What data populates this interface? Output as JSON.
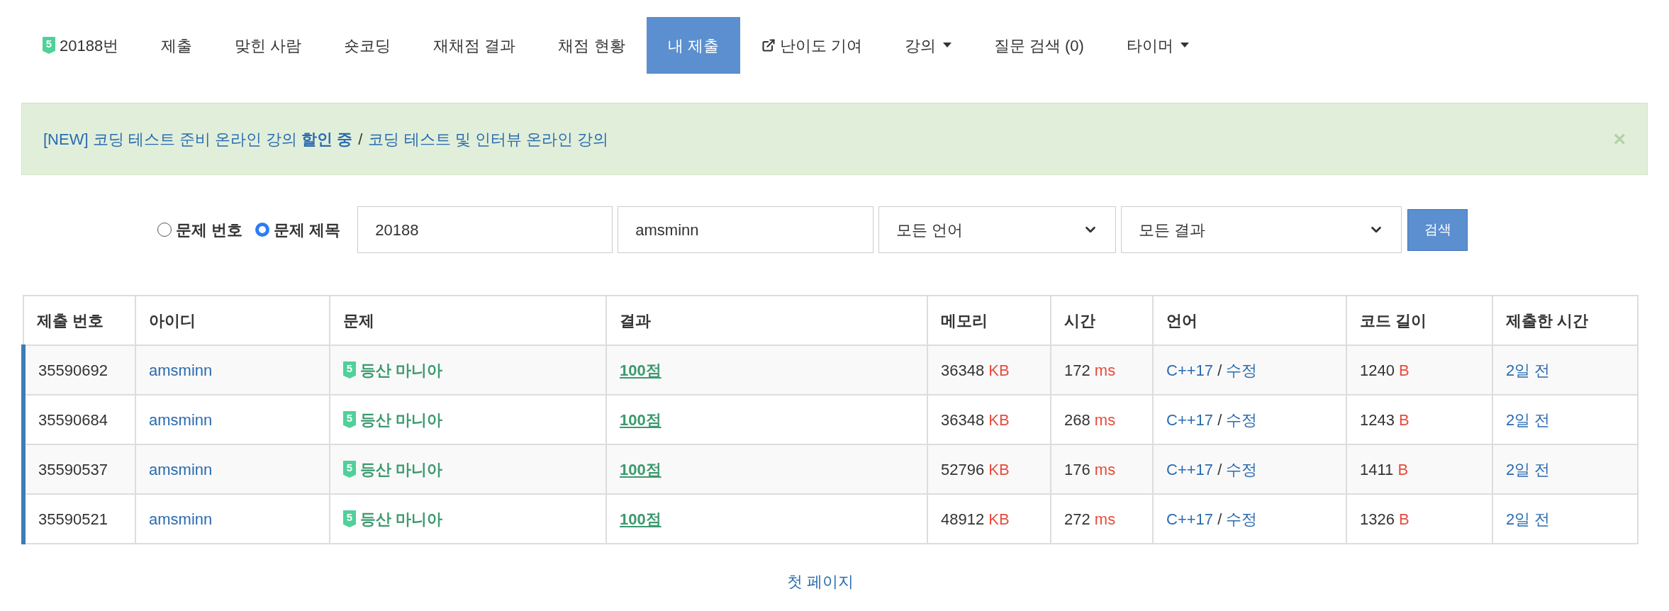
{
  "nav": [
    {
      "label": "20188번",
      "kind": "problem",
      "tier": "5",
      "selected": false
    },
    {
      "label": "제출",
      "kind": "plain",
      "selected": false
    },
    {
      "label": "맞힌 사람",
      "kind": "plain",
      "selected": false
    },
    {
      "label": "숏코딩",
      "kind": "plain",
      "selected": false
    },
    {
      "label": "재채점 결과",
      "kind": "plain",
      "selected": false
    },
    {
      "label": "채점 현황",
      "kind": "plain",
      "selected": false
    },
    {
      "label": "내 제출",
      "kind": "plain",
      "selected": true
    },
    {
      "label": "난이도 기여",
      "kind": "external",
      "selected": false
    },
    {
      "label": "강의",
      "kind": "dropdown",
      "selected": false
    },
    {
      "label": "질문 검색 (0)",
      "kind": "plain",
      "selected": false
    },
    {
      "label": "타이머",
      "kind": "dropdown",
      "selected": false
    }
  ],
  "alert": {
    "link_1": "[NEW] 코딩 테스트 준비 온라인 강의 **할인 중**",
    "separator": "/",
    "link_2": "코딩 테스트 및 인터뷰 온라인 강의",
    "close": "×"
  },
  "search": {
    "radios": [
      {
        "label": "문제 번호",
        "selected": false
      },
      {
        "label": "문제 제목",
        "selected": true
      }
    ],
    "problem_value": "20188",
    "user_value": "amsminn",
    "language": "모든 언어",
    "result": "모든 결과",
    "button": "검색"
  },
  "table": {
    "columns": [
      "제출 번호",
      "아이디",
      "문제",
      "결과",
      "메모리",
      "시간",
      "언어",
      "코드 길이",
      "제출한 시간"
    ],
    "rows": [
      {
        "id": "35590692",
        "user": "amsminn",
        "tier": "5",
        "problem": "등산 마니아",
        "result": "100점",
        "memory": "36348",
        "memory_unit": "KB",
        "time": "172",
        "time_unit": "ms",
        "language": "C++17",
        "separator": "/",
        "edit": "수정",
        "length": "1240",
        "length_unit": "B",
        "submitted": "2일 전"
      },
      {
        "id": "35590684",
        "user": "amsminn",
        "tier": "5",
        "problem": "등산 마니아",
        "result": "100점",
        "memory": "36348",
        "memory_unit": "KB",
        "time": "268",
        "time_unit": "ms",
        "language": "C++17",
        "separator": "/",
        "edit": "수정",
        "length": "1243",
        "length_unit": "B",
        "submitted": "2일 전"
      },
      {
        "id": "35590537",
        "user": "amsminn",
        "tier": "5",
        "problem": "등산 마니아",
        "result": "100점",
        "memory": "52796",
        "memory_unit": "KB",
        "time": "176",
        "time_unit": "ms",
        "language": "C++17",
        "separator": "/",
        "edit": "수정",
        "length": "1411",
        "length_unit": "B",
        "submitted": "2일 전"
      },
      {
        "id": "35590521",
        "user": "amsminn",
        "tier": "5",
        "problem": "등산 마니아",
        "result": "100점",
        "memory": "48912",
        "memory_unit": "KB",
        "time": "272",
        "time_unit": "ms",
        "language": "C++17",
        "separator": "/",
        "edit": "수정",
        "length": "1326",
        "length_unit": "B",
        "submitted": "2일 전"
      }
    ]
  },
  "pagination": {
    "first": "첫 페이지"
  }
}
